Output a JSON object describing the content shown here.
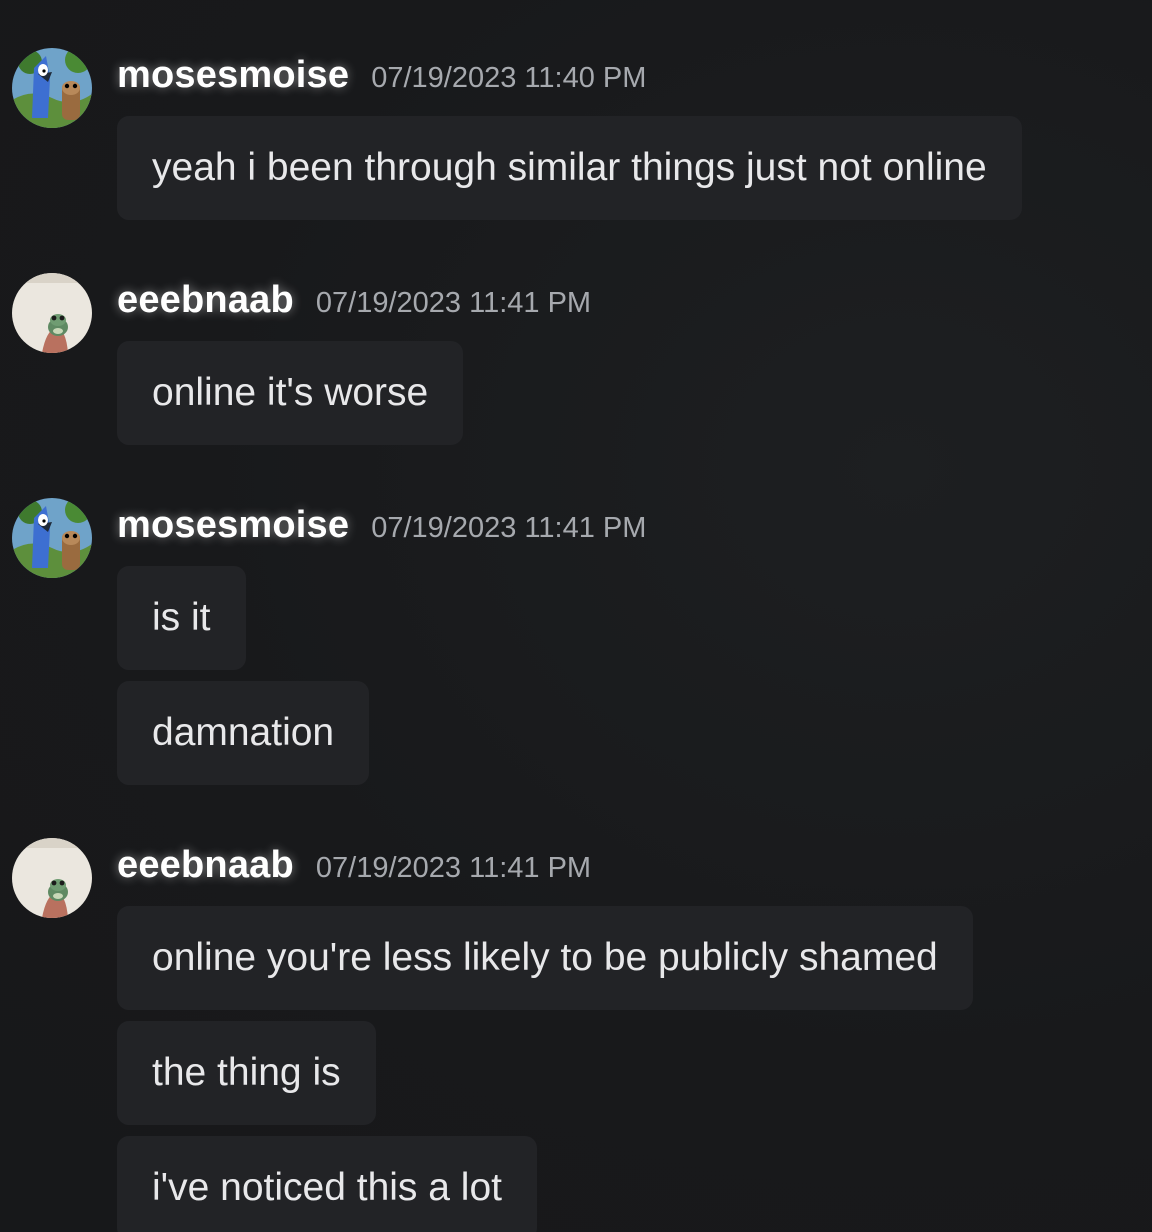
{
  "messages": [
    {
      "author": "mosesmoise",
      "timestamp": "07/19/2023 11:40 PM",
      "avatar_icon": "mordecai-rigby-avatar-icon",
      "lines": [
        "yeah i been through similar things just not online"
      ]
    },
    {
      "author": "eeebnaab",
      "timestamp": "07/19/2023 11:41 PM",
      "avatar_icon": "frog-avatar-icon",
      "lines": [
        "online it's worse"
      ]
    },
    {
      "author": "mosesmoise",
      "timestamp": "07/19/2023 11:41 PM",
      "avatar_icon": "mordecai-rigby-avatar-icon",
      "lines": [
        "is it",
        "damnation"
      ]
    },
    {
      "author": "eeebnaab",
      "timestamp": "07/19/2023 11:41 PM",
      "avatar_icon": "frog-avatar-icon",
      "lines": [
        "online you're less likely to be publicly shamed",
        "the thing is",
        "i've noticed this a lot"
      ]
    }
  ],
  "colors": {
    "background": "#18191b",
    "bubble": "#222326",
    "username": "#ffffff",
    "timestamp": "#a6a9ae",
    "message_text": "#e8e8ea"
  }
}
